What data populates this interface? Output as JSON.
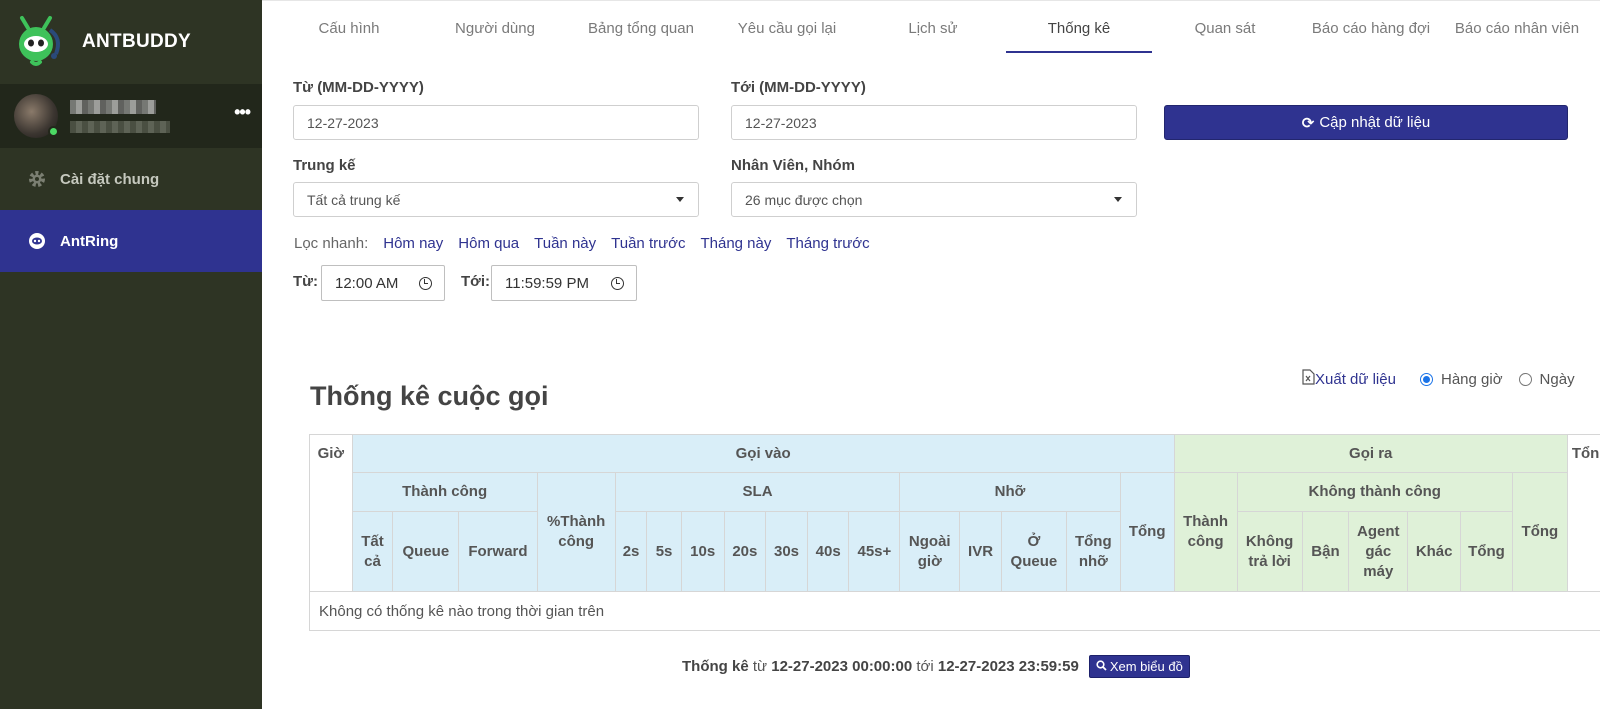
{
  "sidebar": {
    "brand": "ANTBUDDY",
    "items": [
      {
        "label": "Cài đặt chung",
        "icon": "gear-icon"
      },
      {
        "label": "AntRing",
        "icon": "antring-icon"
      }
    ]
  },
  "tabs": [
    "Cấu hình",
    "Người dùng",
    "Bảng tổng quan",
    "Yêu cầu gọi lại",
    "Lịch sử",
    "Thống kê",
    "Quan sát",
    "Báo cáo hàng đợi",
    "Báo cáo nhân viên"
  ],
  "filters": {
    "from_label": "Từ (MM-DD-YYYY)",
    "from_value": "12-27-2023",
    "to_label": "Tới (MM-DD-YYYY)",
    "to_value": "12-27-2023",
    "update_button": "Cập nhật dữ liệu",
    "trunk_label": "Trung kế",
    "trunk_value": "Tất cả trung kế",
    "staff_label": "Nhân Viên, Nhóm",
    "staff_value": "26 mục được chọn",
    "quick_label": "Lọc nhanh:",
    "quick": [
      "Hôm nay",
      "Hôm qua",
      "Tuần này",
      "Tuần trước",
      "Tháng này",
      "Tháng trước"
    ],
    "time_from_label": "Từ:",
    "time_from_value": "12:00  AM",
    "time_to_label": "Tới:",
    "time_to_value": "11:59:59  PM"
  },
  "stats": {
    "title": "Thống kê cuộc gọi",
    "export": "Xuất dữ liệu",
    "radio_hourly": "Hàng giờ",
    "radio_daily": "Ngày",
    "table": {
      "hour": "Giờ",
      "inbound": "Gọi vào",
      "outbound": "Gọi ra",
      "total_partial": "Tổn",
      "in_success": "Thành công",
      "in_success_rate": "%Thành công",
      "sla": "SLA",
      "missed": "Nhỡ",
      "in_total": "Tổng",
      "out_success": "Thành công",
      "out_fail": "Không thành công",
      "out_total": "Tổng",
      "success_cols": [
        "Tất cả",
        "Queue",
        "Forward"
      ],
      "sla_cols": [
        "2s",
        "5s",
        "10s",
        "20s",
        "30s",
        "40s",
        "45s+"
      ],
      "missed_cols": [
        "Ngoài giờ",
        "IVR",
        "Ở Queue",
        "Tổng nhỡ"
      ],
      "fail_cols": [
        "Không trả lời",
        "Bận",
        "Agent gác máy",
        "Khác",
        "Tổng"
      ],
      "empty_message": "Không có thống kê nào trong thời gian trên"
    }
  },
  "footer": {
    "label": "Thống kê",
    "from_word": "từ",
    "from": "12-27-2023 00:00:00",
    "to_word": "tới",
    "to": "12-27-2023 23:59:59",
    "chart_button": "Xem biểu đồ"
  }
}
